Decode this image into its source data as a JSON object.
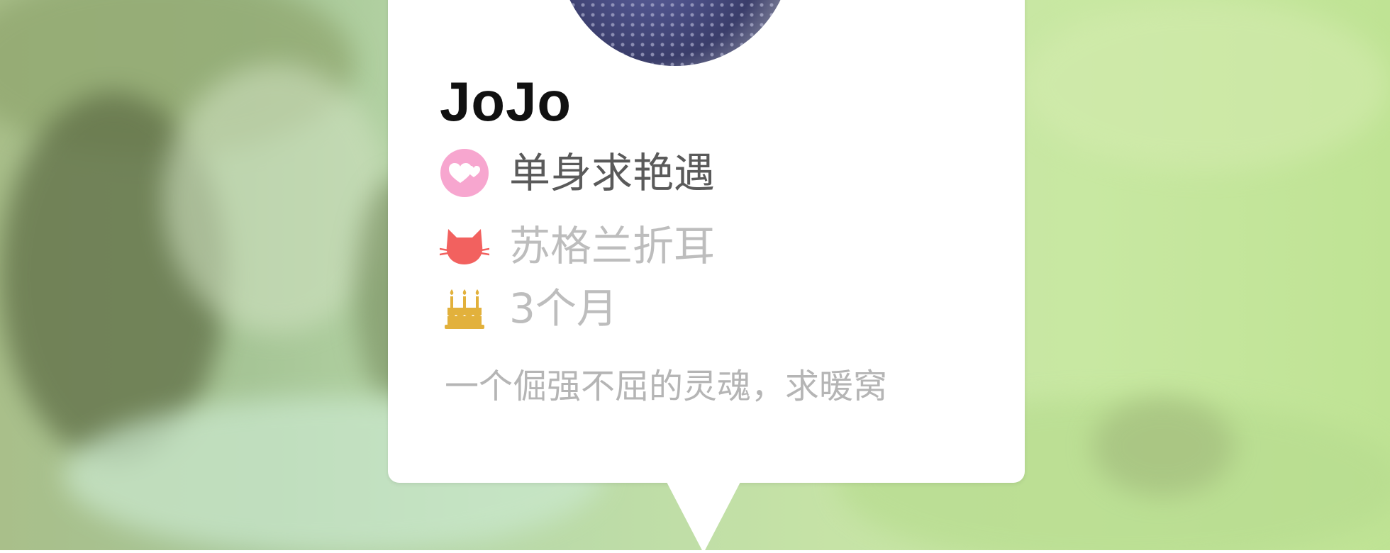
{
  "colors": {
    "card_bg": "#ffffff",
    "name": "#111111",
    "relationship_text": "#5a5a5a",
    "muted_text": "#bdbdbd",
    "heart_badge": "#f7a6cf",
    "cat_icon": "#f2615f",
    "cake_icon": "#e2b13c"
  },
  "icons": {
    "relationship": "hearts-icon",
    "breed": "cat-icon",
    "age": "birthday-cake-icon"
  },
  "profile": {
    "name": "JoJo",
    "relationship_status": "单身求艳遇",
    "breed": "苏格兰折耳",
    "age": "3个月",
    "bio": "一个倔强不屈的灵魂，求暖窝"
  }
}
